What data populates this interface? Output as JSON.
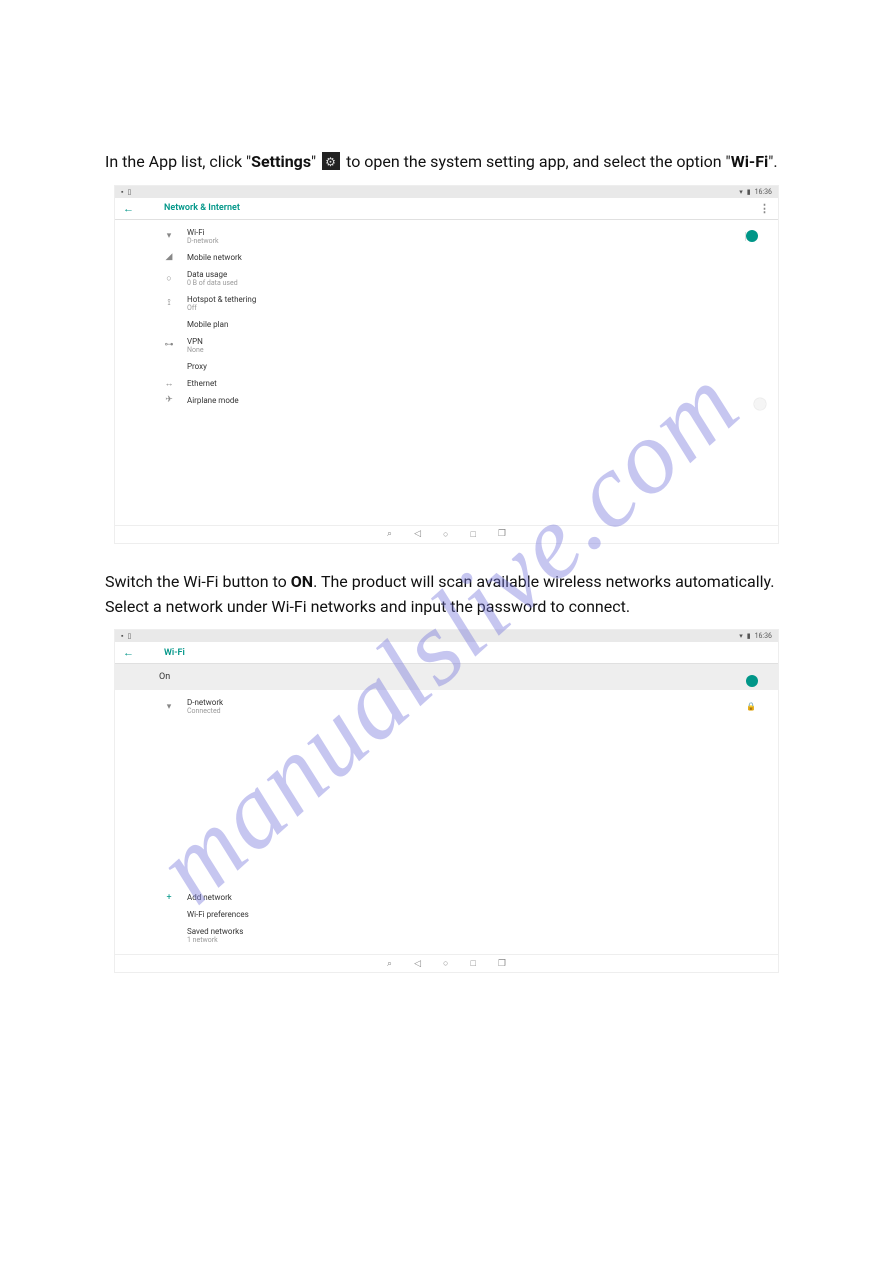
{
  "watermark": "manualslive.com",
  "intro1": {
    "p1": "In the App list, click \"",
    "settings": "Settings",
    "p2": "\" ",
    "p3": " to open the system setting app, and select the option \"",
    "wifi": "Wi-Fi",
    "p4": "\"."
  },
  "intro2": {
    "p1": "Switch the Wi-Fi button to ",
    "on": "ON",
    "p2": ". The product will scan available wireless networks automatically. Select a network under Wi-Fi networks and input the password to connect."
  },
  "status": {
    "time": "16:36",
    "wifi": "▾",
    "batt": "▮",
    "left1": "▪",
    "left2": "▯"
  },
  "shot1": {
    "title": "Network & Internet",
    "items": [
      {
        "icon": "▾",
        "t1": "Wi-Fi",
        "t2": "D-network",
        "toggle": "on"
      },
      {
        "icon": "◢",
        "t1": "Mobile network",
        "t2": ""
      },
      {
        "icon": "○",
        "t1": "Data usage",
        "t2": "0 B of data used"
      },
      {
        "icon": "⟟",
        "t1": "Hotspot & tethering",
        "t2": "Off"
      },
      {
        "icon": "",
        "t1": "Mobile plan",
        "t2": ""
      },
      {
        "icon": "⊶",
        "t1": "VPN",
        "t2": "None"
      },
      {
        "icon": "",
        "t1": "Proxy",
        "t2": ""
      },
      {
        "icon": "↔",
        "t1": "Ethernet",
        "t2": ""
      },
      {
        "icon": "✈",
        "t1": "Airplane mode",
        "t2": "",
        "toggle": "off"
      }
    ]
  },
  "shot2": {
    "title": "Wi-Fi",
    "on": "On",
    "network": {
      "name": "D-network",
      "status": "Connected"
    },
    "add": "Add network",
    "pref": "Wi-Fi preferences",
    "saved": {
      "t1": "Saved networks",
      "t2": "1 network"
    }
  },
  "nav": [
    "⌕",
    "◁",
    "○",
    "□",
    "❐"
  ]
}
